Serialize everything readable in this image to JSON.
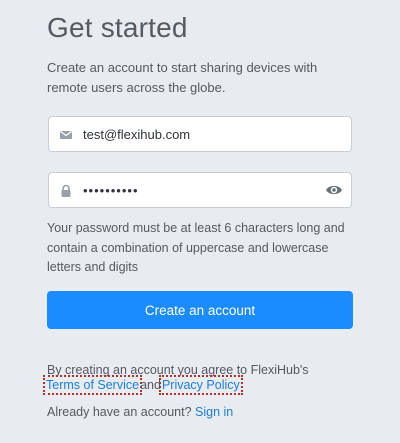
{
  "heading": "Get started",
  "subtitle": "Create an account to start sharing devices with remote users across the globe.",
  "email_field": {
    "value": "test@flexihub.com",
    "icon": "envelope-icon"
  },
  "password_field": {
    "value": "••••••••••",
    "icon": "lock-icon",
    "toggle_icon": "eye-icon"
  },
  "password_hint": "Your password must be at least 6 characters long and contain a combination of uppercase and lowercase letters and digits",
  "create_button_label": "Create an account",
  "agreement": {
    "prefix": "By creating an account you agree to FlexiHub's",
    "terms_link": "Terms of Service",
    "conjunction": "and",
    "privacy_link": "Privacy Policy"
  },
  "signin": {
    "prompt": "Already have an account?",
    "link": "Sign in"
  },
  "colors": {
    "accent": "#1a8cff",
    "link": "#1c7fd6",
    "background": "#e8ebf0"
  }
}
